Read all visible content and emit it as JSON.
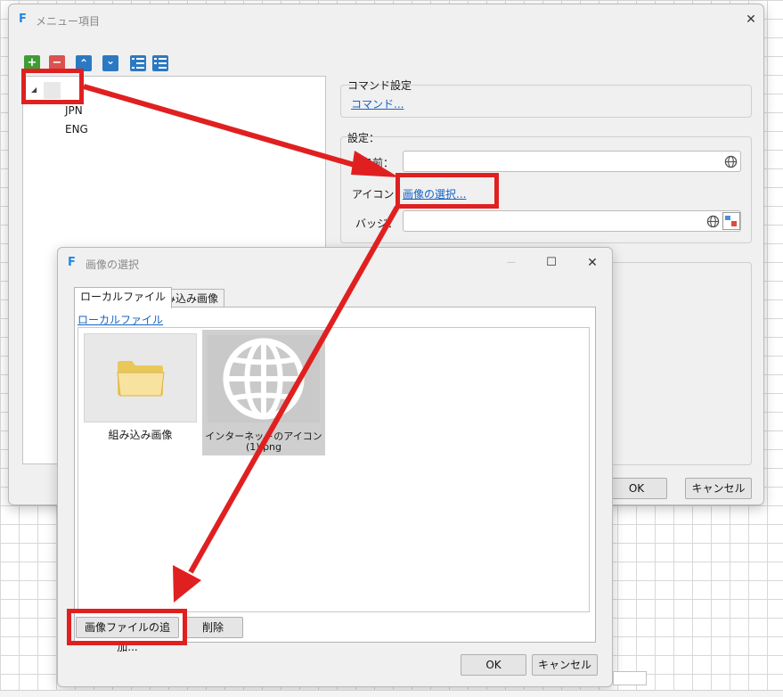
{
  "main_dialog": {
    "title": "メニュー項目",
    "close_glyph": "✕",
    "toolbar": {
      "add_glyph": "+",
      "remove_glyph": "−",
      "up_glyph": "⌃",
      "down_glyph": "⌄"
    },
    "tree": {
      "expander_glyph": "◢",
      "children": [
        "JPN",
        "ENG"
      ]
    },
    "command_group": {
      "title": "コマンド設定",
      "link": "コマンド..."
    },
    "settings_group": {
      "title": "設定：",
      "name_label": "名前：",
      "icon_label": "アイコン：",
      "icon_link": "画像の選択...",
      "badge_label": "バッジ："
    },
    "ok_label": "OK",
    "cancel_label": "キャンセル"
  },
  "image_dialog": {
    "title": "画像の選択",
    "minimize_glyph": "—",
    "maximize_glyph": "☐",
    "close_glyph": "✕",
    "tabs": [
      "ローカルファイル",
      "組み込み画像"
    ],
    "active_tab": 0,
    "breadcrumb": "ローカルファイル",
    "tiles": [
      {
        "label": "組み込み画像",
        "icon": "folder-icon"
      },
      {
        "label_line1": "インターネットのアイコン",
        "label_line2": "(1).png",
        "icon": "globe-icon",
        "selected": true
      }
    ],
    "add_button": "画像ファイルの追加...",
    "delete_button": "削除",
    "ok_label": "OK",
    "cancel_label": "キャンセル"
  },
  "colors": {
    "accent_red": "#e02020",
    "link_blue": "#1463c6",
    "add_green": "#3f9c35",
    "remove_red": "#d9534f",
    "nav_blue": "#2b79c2"
  }
}
